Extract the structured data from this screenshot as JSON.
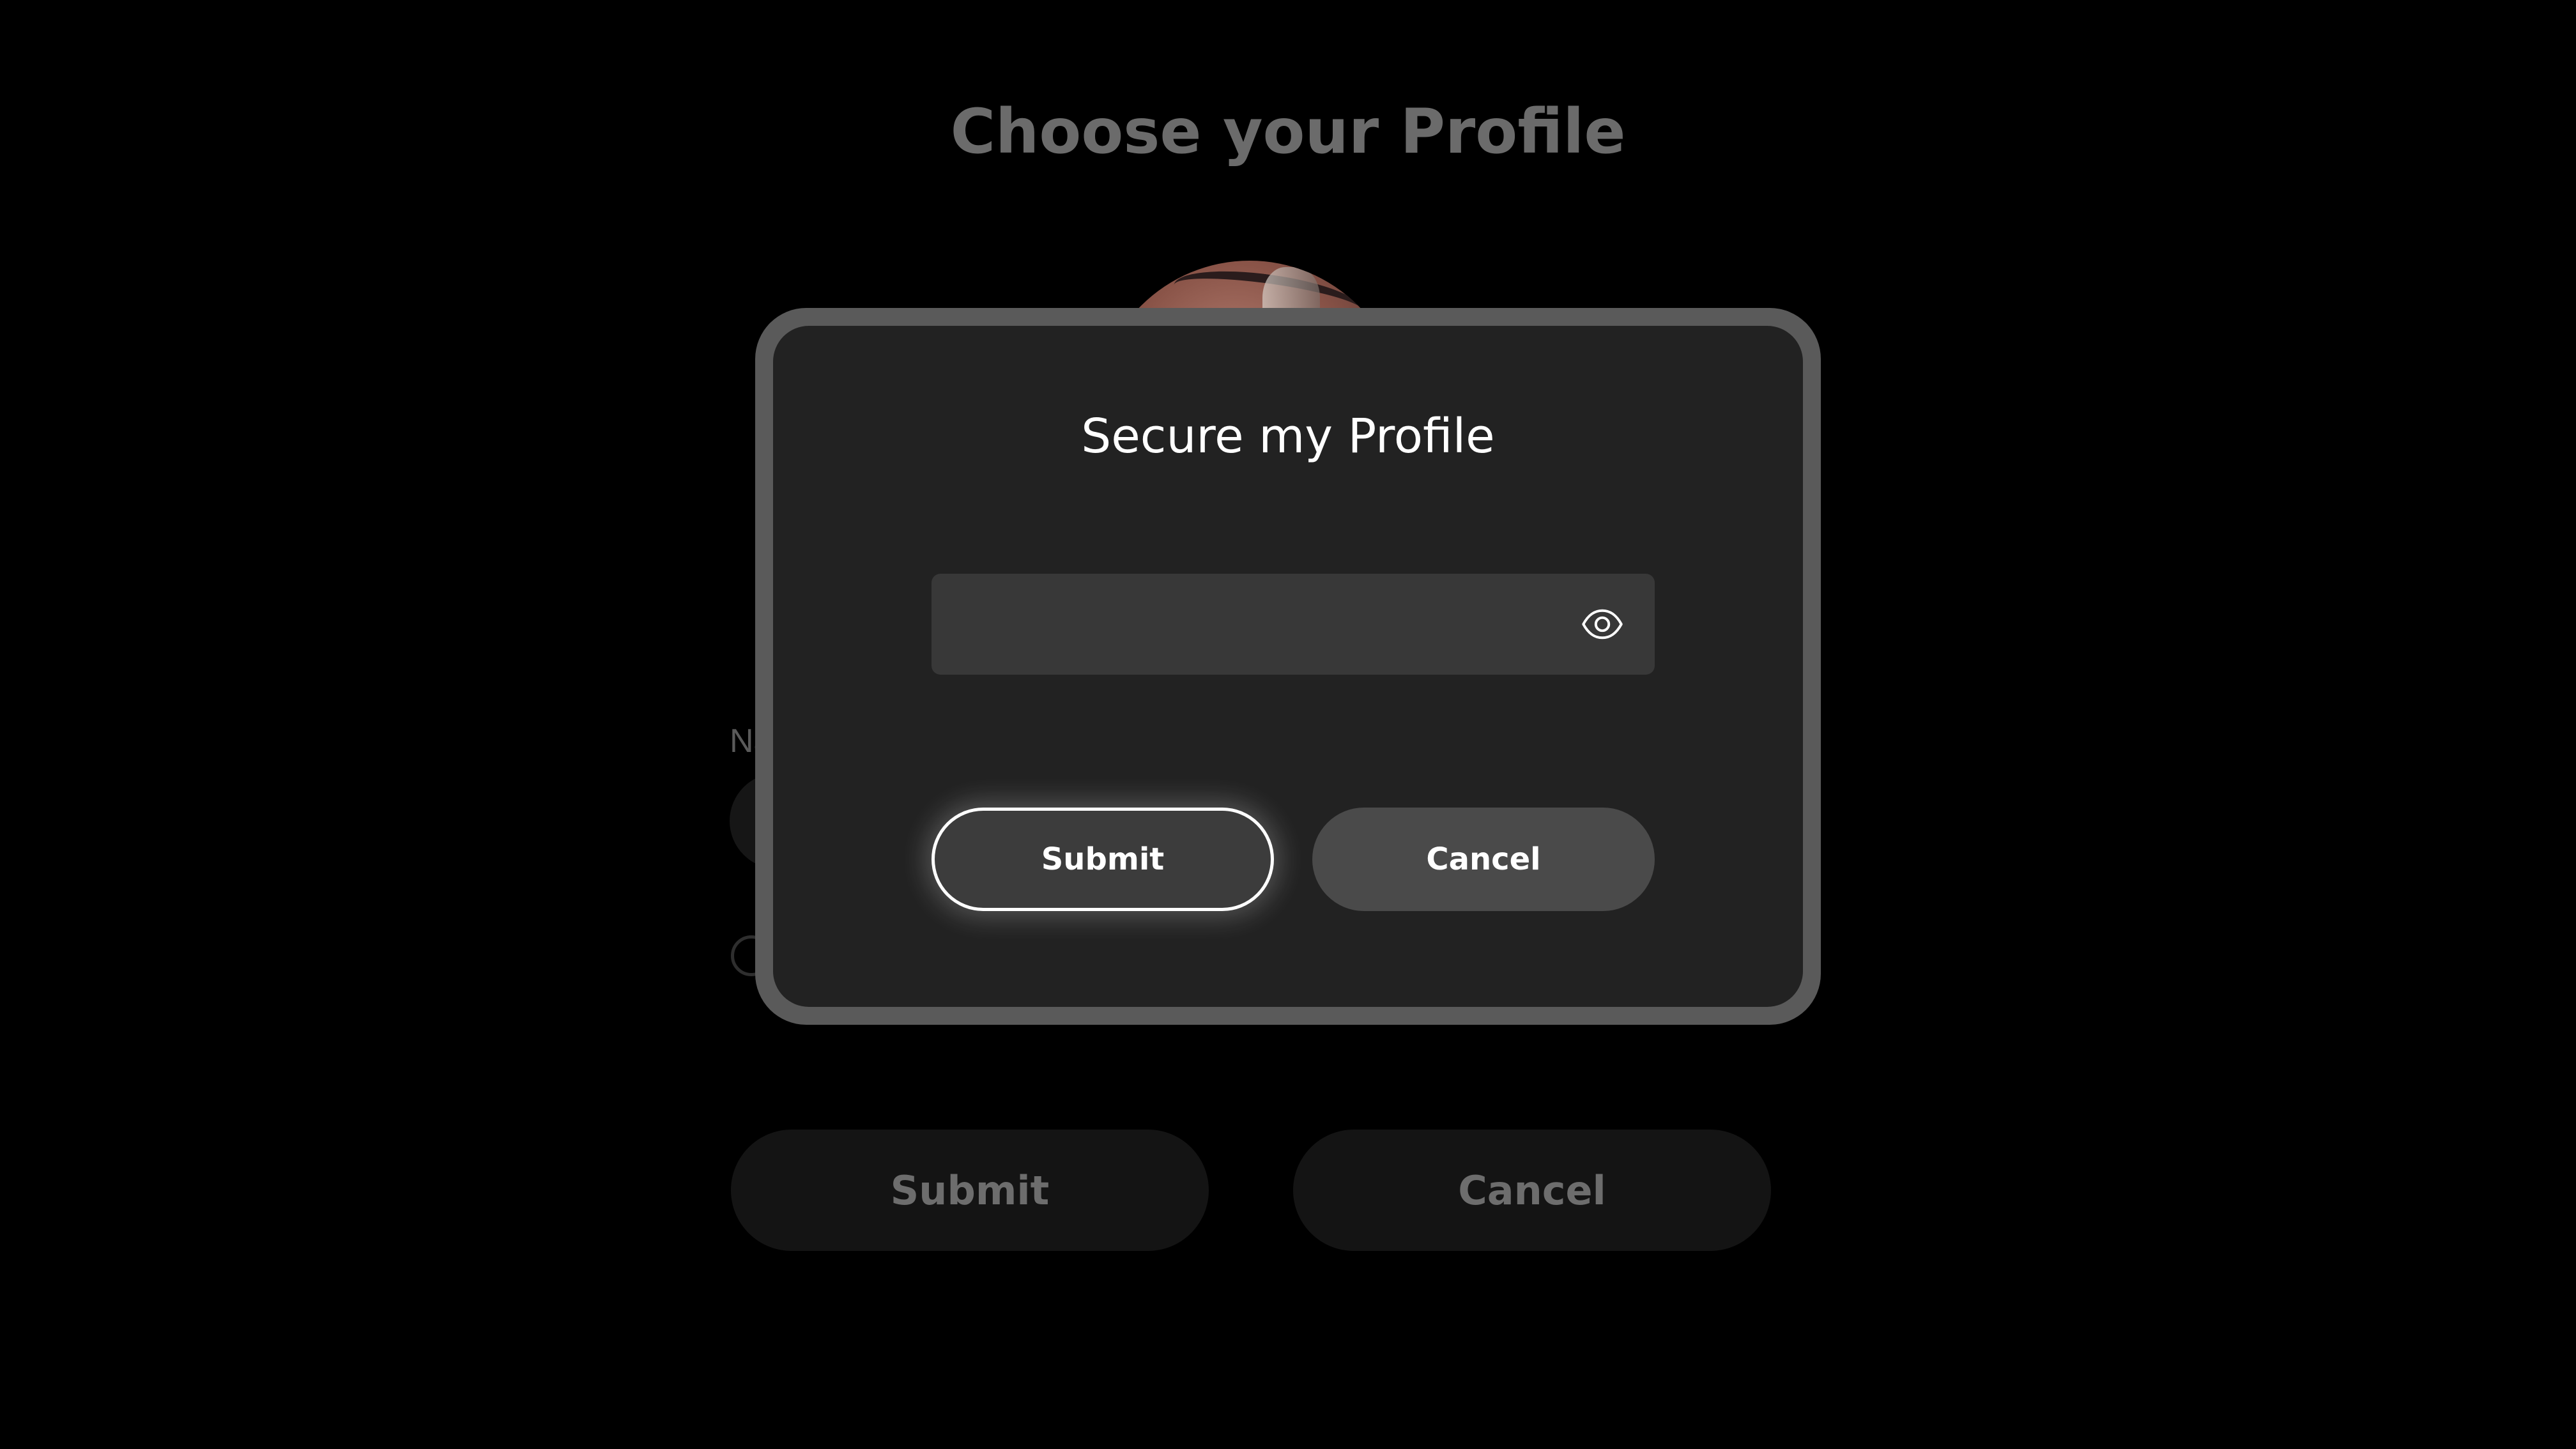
{
  "background": {
    "title": "Choose your Profile",
    "name_label_partial": "Na",
    "submit_label": "Submit",
    "cancel_label": "Cancel"
  },
  "modal": {
    "title": "Secure my Profile",
    "password": {
      "value": "",
      "placeholder": "",
      "icon": "eye-icon"
    },
    "submit_label": "Submit",
    "cancel_label": "Cancel"
  },
  "colors": {
    "page_background": "#000000",
    "modal_background": "#222222",
    "modal_border": "#5a5a5a",
    "input_background": "#383838",
    "focused_button_border": "#ffffff",
    "secondary_button": "#4a4a4a"
  }
}
